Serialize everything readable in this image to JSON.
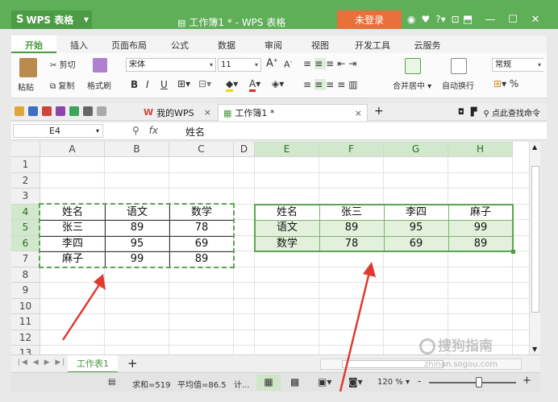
{
  "titlebar": {
    "app_menu": "WPS 表格",
    "doc_title": "工作簿1 * - WPS 表格",
    "login": "未登录",
    "icons": [
      "skin-icon",
      "shirt-icon",
      "help-icon",
      "feedback-icon"
    ],
    "help": "?"
  },
  "ribbon": {
    "tabs": [
      "开始",
      "插入",
      "页面布局",
      "公式",
      "数据",
      "审阅",
      "视图",
      "开发工具",
      "云服务"
    ],
    "active_tab": "开始",
    "clipboard": {
      "paste": "粘贴",
      "cut": "剪切",
      "copy": "复制",
      "format_painter": "格式刷"
    },
    "font": {
      "name": "宋体",
      "size": "11",
      "bold": "B",
      "italic": "I",
      "underline": "U",
      "grow": "A",
      "shrink": "A"
    },
    "merge": "合并居中",
    "wrap": "自动换行",
    "number_format": "常规",
    "percent": "%"
  },
  "quickbar": {
    "tabs": [
      {
        "label": "我的WPS",
        "close": "×"
      },
      {
        "label": "工作簿1 *",
        "close": "×"
      }
    ],
    "add_tab": "+",
    "search": "点此查找命令"
  },
  "formula_bar": {
    "name_box": "E4",
    "fx": "fx",
    "content": "姓名"
  },
  "grid": {
    "columns": [
      "A",
      "B",
      "C",
      "D",
      "E",
      "F",
      "G",
      "H"
    ],
    "rows": [
      "1",
      "2",
      "3",
      "4",
      "5",
      "6",
      "7",
      "8",
      "9",
      "10",
      "11",
      "12",
      "13"
    ],
    "left_table": [
      [
        "姓名",
        "语文",
        "数学"
      ],
      [
        "张三",
        "89",
        "78"
      ],
      [
        "李四",
        "95",
        "69"
      ],
      [
        "麻子",
        "99",
        "89"
      ]
    ],
    "right_table": [
      [
        "姓名",
        "张三",
        "李四",
        "麻子"
      ],
      [
        "语文",
        "89",
        "95",
        "99"
      ],
      [
        "数学",
        "78",
        "69",
        "89"
      ]
    ]
  },
  "sheets": {
    "tabs": [
      "工作表1"
    ],
    "add": "+"
  },
  "status": {
    "sum": "求和=519",
    "average": "平均值=86.5",
    "count": "计...",
    "zoom": "120 %",
    "zoom_minus": "-",
    "zoom_plus": "+"
  },
  "watermark": {
    "brand": "搜狗指南",
    "url": "zhinan.sogou.com"
  },
  "colors": {
    "wps_green": "#5fae58",
    "accent": "#4a9a3f",
    "login_orange": "#e8703a",
    "arrow_red": "#e03a2f",
    "selection_fill": "#e3f1dc"
  }
}
